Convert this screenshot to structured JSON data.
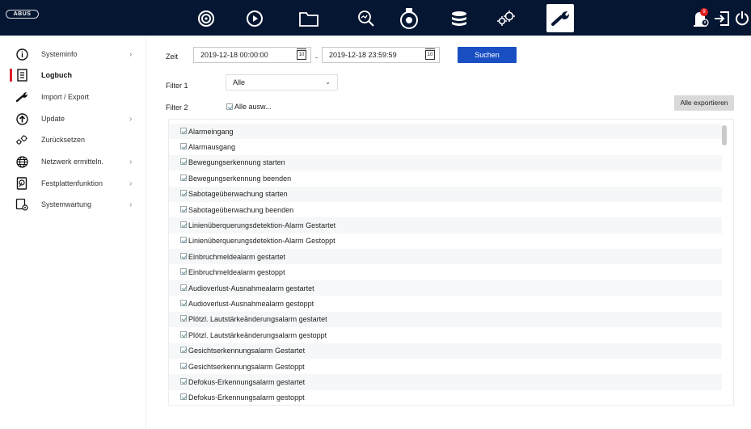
{
  "topbar": {
    "logo": "ABUS",
    "nav_icons": [
      "live-view-icon",
      "playback-icon",
      "files-icon",
      "search-analysis-icon",
      "camera-icon",
      "storage-icon",
      "settings-icon",
      "maintenance-icon"
    ],
    "active_nav": "maintenance-icon",
    "alarm_badge": "9",
    "colors": {
      "bar": "#051632",
      "accent": "#e0202a",
      "primary_button": "#1a4fc4"
    }
  },
  "sidebar": {
    "items": [
      {
        "label": "Systeminfo",
        "icon": "info-icon",
        "has_submenu": true
      },
      {
        "label": "Logbuch",
        "icon": "log-icon",
        "has_submenu": false,
        "active": true
      },
      {
        "label": "Import / Export",
        "icon": "wrench-icon",
        "has_submenu": false
      },
      {
        "label": "Update",
        "icon": "upload-icon",
        "has_submenu": true
      },
      {
        "label": "Zurücksetzen",
        "icon": "reset-gears-icon",
        "has_submenu": false
      },
      {
        "label": "Netzwerk ermitteln.",
        "icon": "globe-icon",
        "has_submenu": true
      },
      {
        "label": "Festplattenfunktion",
        "icon": "hdd-icon",
        "has_submenu": true
      },
      {
        "label": "Systemwartung",
        "icon": "system-maintenance-icon",
        "has_submenu": true
      }
    ],
    "chevron": "›"
  },
  "filters": {
    "time_label": "Zeit",
    "start_time": "2019-12-18 00:00:00",
    "separator": "-",
    "end_time": "2019-12-18 23:59:59",
    "calendar_day": "10",
    "search_button": "Suchen",
    "filter1_label": "Filter 1",
    "filter1_value": "Alle",
    "filter1_arrow": "⌄",
    "filter2_label": "Filter 2",
    "select_all_label": "Alle ausw...",
    "export_all_button": "Alle exportieren"
  },
  "log_types": [
    "Alarmeingang",
    "Alarmausgang",
    "Bewegungserkennung starten",
    "Bewegungserkennung beenden",
    "Sabotageüberwachung starten",
    "Sabotageüberwachung beenden",
    "Linienüberquerungsdetektion-Alarm Gestartet",
    "Linienüberquerungsdetektion-Alarm Gestoppt",
    "Einbruchmeldealarm gestartet",
    "Einbruchmeldealarm gestoppt",
    "Audioverlust-Ausnahmealarm gestartet",
    "Audioverlust-Ausnahmealarm gestoppt",
    "Plötzl. Lautstärkeänderungsalarm gestartet",
    "Plötzl. Lautstärkeänderungsalarm gestoppt",
    "Gesichtserkennungsalarm Gestartet",
    "Gesichtserkennungsalarm Gestoppt",
    "Defokus-Erkennungsalarm gestartet",
    "Defokus-Erkennungsalarm gestoppt"
  ]
}
